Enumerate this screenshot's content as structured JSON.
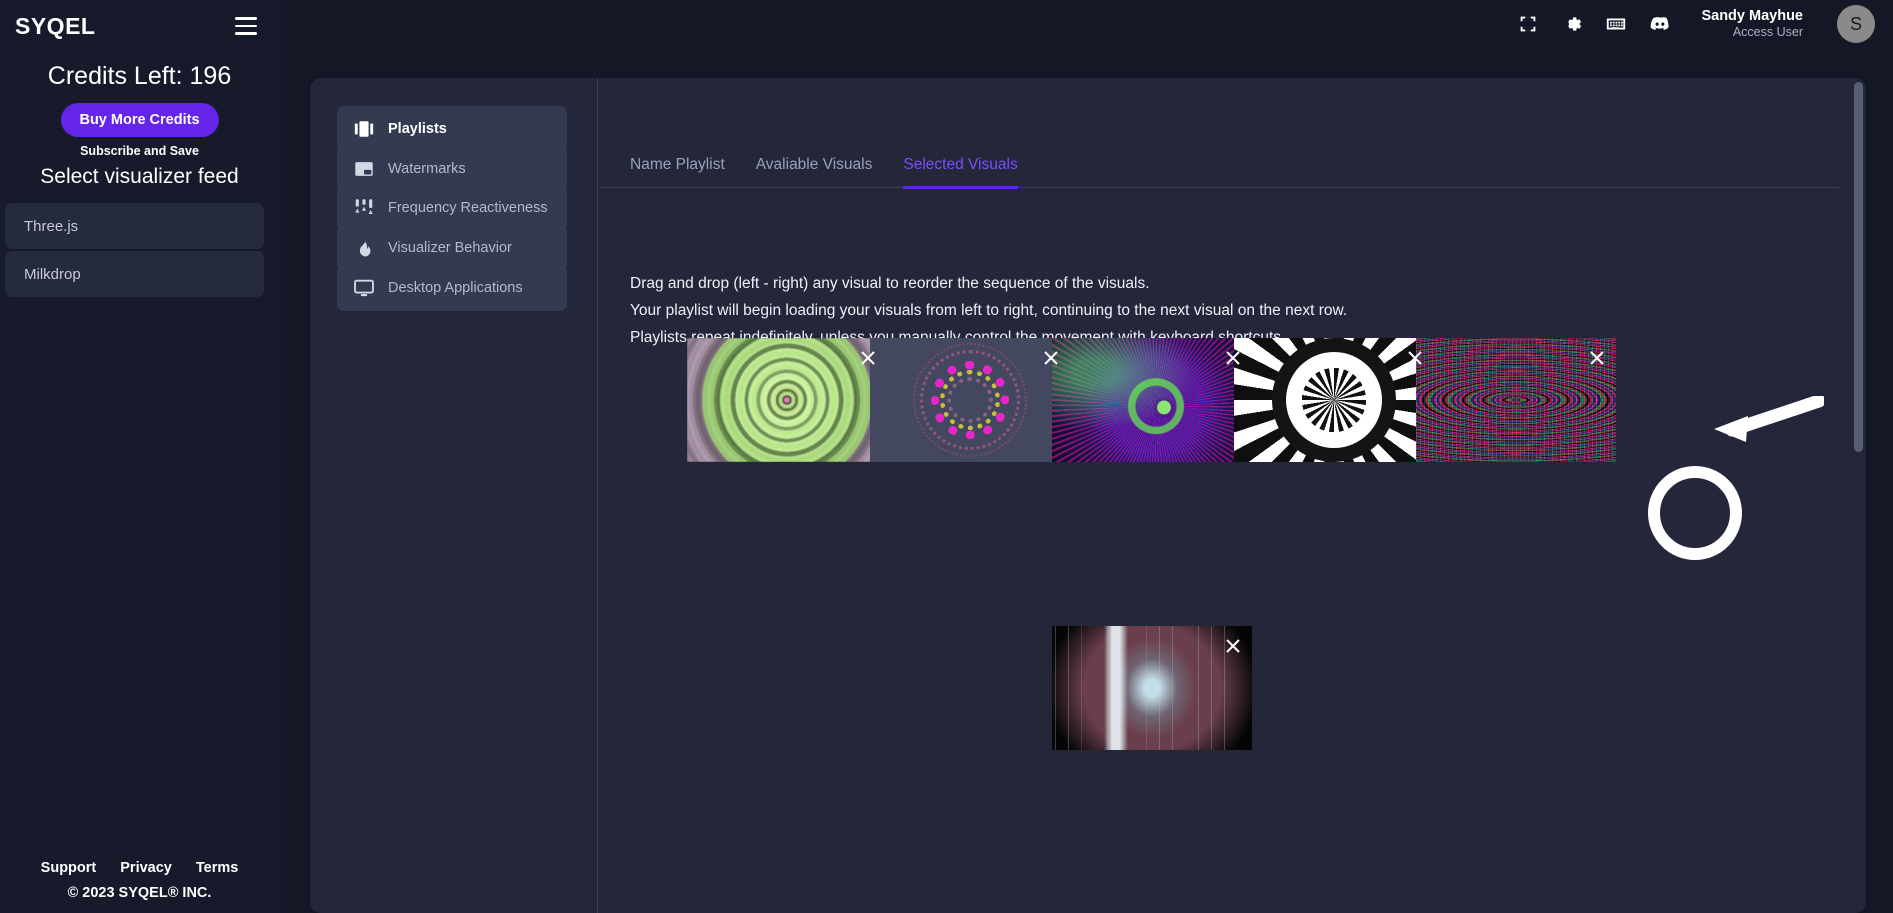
{
  "sidebar": {
    "brand": "SYQEL",
    "menu_icon": "hamburger-icon",
    "credits_label": "Credits Left: 196",
    "buy_credits_label": "Buy More Credits",
    "subscribe_note": "Subscribe and Save",
    "feed_title": "Select visualizer feed",
    "feeds": [
      {
        "label": "Three.js"
      },
      {
        "label": "Milkdrop"
      }
    ],
    "footer": {
      "links": [
        {
          "label": "Support"
        },
        {
          "label": "Privacy"
        },
        {
          "label": "Terms"
        }
      ],
      "copyright": "© 2023 SYQEL® INC."
    }
  },
  "header": {
    "icons": [
      {
        "name": "fullscreen-icon"
      },
      {
        "name": "gear-icon"
      },
      {
        "name": "keyboard-icon"
      },
      {
        "name": "discord-icon"
      }
    ],
    "user": {
      "name": "Sandy Mayhue",
      "role": "Access User",
      "avatar_initial": "S"
    }
  },
  "menu_panel": {
    "items": [
      {
        "label": "Playlists",
        "icon": "playlists-icon",
        "active": true
      },
      {
        "label": "Watermarks",
        "icon": "watermark-icon",
        "active": false
      },
      {
        "label": "Frequency Reactiveness",
        "icon": "sliders-icon",
        "active": false
      },
      {
        "label": "Visualizer Behavior",
        "icon": "flame-icon",
        "active": false
      },
      {
        "label": "Desktop Applications",
        "icon": "monitor-icon",
        "active": false
      }
    ]
  },
  "content": {
    "tabs": [
      {
        "label": "Name Playlist",
        "active": false
      },
      {
        "label": "Avaliable Visuals",
        "active": false
      },
      {
        "label": "Selected Visuals",
        "active": true
      }
    ],
    "instructions": [
      "Drag and drop (left - right) any visual to reorder the sequence of the visuals.",
      "Your playlist will begin loading your visuals from left to right, continuing to the next visual on the next row.",
      "Playlists repeat indefinitely, unless you manually control the movement with keyboard shortcuts."
    ],
    "visuals": [
      {
        "name": "green-fractal-visual",
        "remove_icon": "close-icon"
      },
      {
        "name": "magenta-ring-mandala-visual",
        "remove_icon": "close-icon"
      },
      {
        "name": "purple-galaxy-visual",
        "remove_icon": "close-icon"
      },
      {
        "name": "monochrome-gear-visual",
        "remove_icon": "close-icon"
      },
      {
        "name": "kaleidoscope-visual",
        "remove_icon": "close-icon"
      },
      {
        "name": "light-streaks-visual",
        "remove_icon": "close-icon"
      }
    ],
    "annotation": {
      "highlight_target": "remove-visual-button",
      "arrow": "pointer-arrow"
    }
  },
  "colors": {
    "page_bg": "#141726",
    "sidebar_bg": "#161a2b",
    "card_bg": "#232739",
    "accent_purple": "#6425e8",
    "tab_active": "#7c4dff",
    "menu_item_bg": "#343a4f",
    "text_primary": "#ffffff",
    "text_muted": "#9aa1b7"
  }
}
